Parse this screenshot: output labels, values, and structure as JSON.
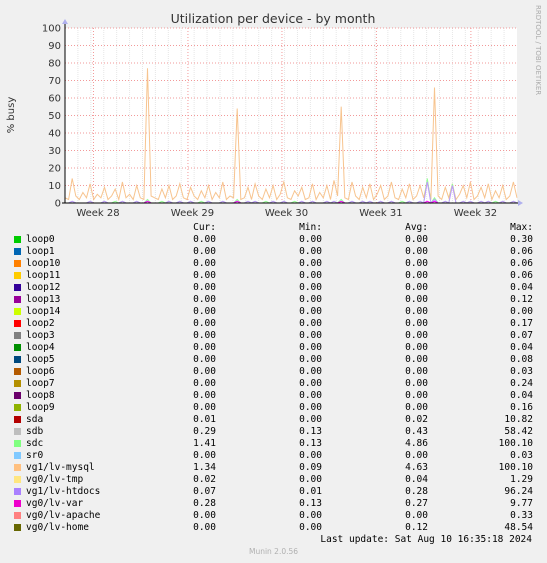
{
  "chart_data": {
    "type": "line",
    "title": "Utilization per device - by month",
    "ylabel": "% busy",
    "xlabel": "",
    "watermark": "RRDTOOL / TOBI OETIKER",
    "ylim": [
      0,
      100
    ],
    "yticks": [
      0,
      10,
      20,
      30,
      40,
      50,
      60,
      70,
      80,
      90,
      100
    ],
    "xticks": [
      "Week 28",
      "Week 29",
      "Week 30",
      "Week 31",
      "Week 32"
    ],
    "grid": true,
    "colors": {
      "background": "#f0f0f0",
      "plot_bg": "#ffffff",
      "grid_minor": "#e6e6e6",
      "grid_major": "#f29999",
      "axis": "#000000"
    },
    "series": [
      {
        "name": "vg1/lv-mysql",
        "color": "#f7c48f",
        "values": [
          3,
          2,
          14,
          4,
          2,
          6,
          3,
          11,
          2,
          5,
          3,
          9,
          2,
          4,
          8,
          2,
          12,
          3,
          5,
          2,
          10,
          3,
          2,
          77,
          4,
          3,
          2,
          8,
          3,
          10,
          2,
          4,
          11,
          3,
          2,
          9,
          4,
          2,
          7,
          3,
          10,
          2,
          6,
          3,
          12,
          2,
          4,
          3,
          54,
          2,
          3,
          9,
          2,
          11,
          4,
          2,
          8,
          3,
          10,
          2,
          5,
          12,
          3,
          2,
          7,
          4,
          9,
          2,
          3,
          11,
          2,
          6,
          3,
          10,
          2,
          13,
          4,
          55,
          3,
          2,
          12,
          4,
          2,
          9,
          3,
          11,
          2,
          5,
          10,
          2,
          4,
          12,
          3,
          2,
          8,
          3,
          11,
          2,
          4,
          10,
          3,
          13,
          2,
          66,
          4,
          2,
          9,
          3,
          11,
          2,
          5,
          10,
          3,
          12,
          2,
          4,
          9,
          3,
          11,
          2,
          7,
          3,
          10,
          2,
          4,
          12,
          3
        ]
      },
      {
        "name": "sdc",
        "color": "#96ff96",
        "values": [
          0,
          0,
          1,
          0,
          0,
          0,
          0,
          1,
          0,
          0,
          0,
          1,
          0,
          0,
          1,
          0,
          1,
          0,
          0,
          0,
          1,
          0,
          0,
          2,
          0,
          0,
          0,
          1,
          0,
          1,
          0,
          0,
          1,
          0,
          0,
          1,
          0,
          0,
          1,
          0,
          1,
          0,
          0,
          0,
          1,
          0,
          0,
          0,
          2,
          0,
          0,
          1,
          0,
          1,
          0,
          0,
          1,
          0,
          1,
          0,
          0,
          1,
          0,
          0,
          1,
          0,
          1,
          0,
          0,
          1,
          0,
          0,
          0,
          1,
          0,
          1,
          0,
          2,
          0,
          0,
          1,
          0,
          0,
          1,
          0,
          1,
          0,
          0,
          1,
          0,
          0,
          1,
          0,
          0,
          1,
          0,
          1,
          0,
          0,
          1,
          0,
          14,
          0,
          3,
          0,
          0,
          1,
          0,
          11,
          0,
          0,
          1,
          0,
          1,
          0,
          0,
          1,
          0,
          1,
          0,
          1,
          0,
          1,
          0,
          0,
          1,
          0
        ]
      },
      {
        "name": "vg1/lv-htdocs",
        "color": "#c096ff",
        "values": [
          0,
          0,
          1,
          0,
          0,
          0,
          0,
          1,
          0,
          0,
          0,
          1,
          0,
          0,
          0,
          0,
          1,
          0,
          0,
          0,
          1,
          0,
          0,
          1,
          0,
          0,
          0,
          0,
          0,
          1,
          0,
          0,
          1,
          0,
          0,
          1,
          0,
          0,
          0,
          0,
          1,
          0,
          0,
          0,
          1,
          0,
          0,
          0,
          1,
          0,
          0,
          1,
          0,
          1,
          0,
          0,
          0,
          0,
          1,
          0,
          0,
          1,
          0,
          0,
          0,
          0,
          1,
          0,
          0,
          1,
          0,
          0,
          0,
          1,
          0,
          1,
          0,
          1,
          0,
          0,
          1,
          0,
          0,
          1,
          0,
          1,
          0,
          0,
          1,
          0,
          0,
          1,
          0,
          0,
          0,
          0,
          1,
          0,
          0,
          1,
          0,
          12,
          0,
          2,
          0,
          0,
          1,
          0,
          10,
          0,
          0,
          1,
          0,
          1,
          0,
          0,
          1,
          0,
          1,
          0,
          0,
          0,
          1,
          0,
          0,
          1,
          0
        ]
      },
      {
        "name": "vg0/lv-var",
        "color": "#ff00ff",
        "values": [
          0,
          0,
          0,
          0,
          0,
          0,
          0,
          0,
          0,
          0,
          0,
          0,
          0,
          0,
          0,
          0,
          0,
          0,
          0,
          0,
          0,
          0,
          0,
          1,
          0,
          0,
          0,
          0,
          0,
          0,
          0,
          0,
          0,
          0,
          0,
          0,
          0,
          0,
          0,
          0,
          0,
          0,
          0,
          0,
          0,
          0,
          0,
          0,
          1,
          0,
          0,
          0,
          0,
          0,
          0,
          0,
          0,
          0,
          0,
          0,
          0,
          0,
          0,
          0,
          0,
          0,
          0,
          0,
          0,
          0,
          0,
          0,
          0,
          0,
          0,
          0,
          0,
          1,
          0,
          0,
          0,
          0,
          0,
          0,
          0,
          0,
          0,
          0,
          0,
          0,
          0,
          0,
          0,
          0,
          0,
          0,
          0,
          0,
          0,
          0,
          0,
          1,
          0,
          1,
          0,
          0,
          0,
          0,
          0,
          0,
          0,
          0,
          0,
          0,
          0,
          0,
          0,
          0,
          0,
          0,
          0,
          0,
          0,
          0,
          0,
          0,
          0
        ]
      }
    ]
  },
  "legend": {
    "headers": [
      "Cur:",
      "Min:",
      "Avg:",
      "Max:"
    ],
    "rows": [
      {
        "name": "loop0",
        "color": "#00cc00",
        "cur": "0.00",
        "min": "0.00",
        "avg": "0.00",
        "max": "0.30"
      },
      {
        "name": "loop1",
        "color": "#0066b3",
        "cur": "0.00",
        "min": "0.00",
        "avg": "0.00",
        "max": "0.06"
      },
      {
        "name": "loop10",
        "color": "#ff8000",
        "cur": "0.00",
        "min": "0.00",
        "avg": "0.00",
        "max": "0.06"
      },
      {
        "name": "loop11",
        "color": "#ffcc00",
        "cur": "0.00",
        "min": "0.00",
        "avg": "0.00",
        "max": "0.06"
      },
      {
        "name": "loop12",
        "color": "#330099",
        "cur": "0.00",
        "min": "0.00",
        "avg": "0.00",
        "max": "0.04"
      },
      {
        "name": "loop13",
        "color": "#990099",
        "cur": "0.00",
        "min": "0.00",
        "avg": "0.00",
        "max": "0.12"
      },
      {
        "name": "loop14",
        "color": "#ccff00",
        "cur": "0.00",
        "min": "0.00",
        "avg": "0.00",
        "max": "0.00"
      },
      {
        "name": "loop2",
        "color": "#ff0000",
        "cur": "0.00",
        "min": "0.00",
        "avg": "0.00",
        "max": "0.17"
      },
      {
        "name": "loop3",
        "color": "#808080",
        "cur": "0.00",
        "min": "0.00",
        "avg": "0.00",
        "max": "0.07"
      },
      {
        "name": "loop4",
        "color": "#008f00",
        "cur": "0.00",
        "min": "0.00",
        "avg": "0.00",
        "max": "0.04"
      },
      {
        "name": "loop5",
        "color": "#00487d",
        "cur": "0.00",
        "min": "0.00",
        "avg": "0.00",
        "max": "0.08"
      },
      {
        "name": "loop6",
        "color": "#b35a00",
        "cur": "0.00",
        "min": "0.00",
        "avg": "0.00",
        "max": "0.03"
      },
      {
        "name": "loop7",
        "color": "#b38f00",
        "cur": "0.00",
        "min": "0.00",
        "avg": "0.00",
        "max": "0.24"
      },
      {
        "name": "loop8",
        "color": "#6b006b",
        "cur": "0.00",
        "min": "0.00",
        "avg": "0.00",
        "max": "0.04"
      },
      {
        "name": "loop9",
        "color": "#8fb300",
        "cur": "0.00",
        "min": "0.00",
        "avg": "0.00",
        "max": "0.16"
      },
      {
        "name": "sda",
        "color": "#b30000",
        "cur": "0.01",
        "min": "0.00",
        "avg": "0.02",
        "max": "10.82"
      },
      {
        "name": "sdb",
        "color": "#bebebe",
        "cur": "0.29",
        "min": "0.13",
        "avg": "0.43",
        "max": "58.42"
      },
      {
        "name": "sdc",
        "color": "#80ff80",
        "cur": "1.41",
        "min": "0.13",
        "avg": "4.86",
        "max": "100.10"
      },
      {
        "name": "sr0",
        "color": "#80c9ff",
        "cur": "0.00",
        "min": "0.00",
        "avg": "0.00",
        "max": "0.03"
      },
      {
        "name": "vg1/lv-mysql",
        "color": "#ffc080",
        "cur": "1.34",
        "min": "0.09",
        "avg": "4.63",
        "max": "100.10"
      },
      {
        "name": "vg0/lv-tmp",
        "color": "#ffe680",
        "cur": "0.02",
        "min": "0.00",
        "avg": "0.04",
        "max": "1.29"
      },
      {
        "name": "vg1/lv-htdocs",
        "color": "#aa80ff",
        "cur": "0.07",
        "min": "0.01",
        "avg": "0.28",
        "max": "96.24"
      },
      {
        "name": "vg0/lv-var",
        "color": "#ee00cc",
        "cur": "0.28",
        "min": "0.13",
        "avg": "0.27",
        "max": "9.77"
      },
      {
        "name": "vg0/lv-apache",
        "color": "#ff8080",
        "cur": "0.00",
        "min": "0.00",
        "avg": "0.00",
        "max": "0.33"
      },
      {
        "name": "vg0/lv-home",
        "color": "#666600",
        "cur": "0.00",
        "min": "0.00",
        "avg": "0.12",
        "max": "48.54"
      }
    ]
  },
  "footer": {
    "last_update": "Last update: Sat Aug 10 16:35:18 2024",
    "version": "Munin 2.0.56"
  }
}
